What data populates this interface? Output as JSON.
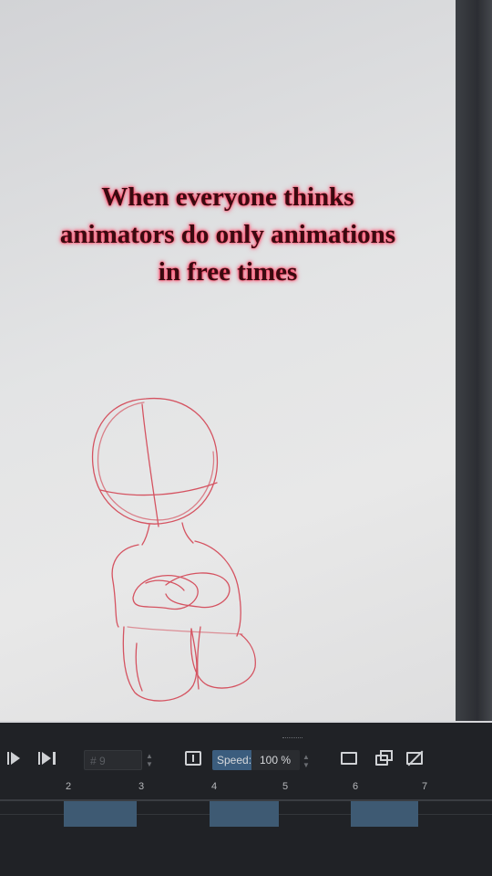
{
  "caption": {
    "line1": "When everyone thinks",
    "line2": "animators do only animations",
    "line3": "in free times"
  },
  "colors": {
    "caption_text": "#3a0a10",
    "caption_glow": "#ff3355",
    "sketch_stroke": "#d23a4a",
    "frame_cell": "#3e5a73"
  },
  "timeline": {
    "play_icon": "play-icon",
    "next_frame_icon": "next-frame-icon",
    "frame_field": "# 9",
    "loop_icon": "frame-loop-icon",
    "speed_label": "Speed:",
    "speed_value": "100 %",
    "view_icons": [
      "single-view-icon",
      "onion-skin-icon",
      "onion-off-icon"
    ],
    "frame_numbers": [
      "2",
      "3",
      "4",
      "5",
      "6",
      "7"
    ]
  }
}
